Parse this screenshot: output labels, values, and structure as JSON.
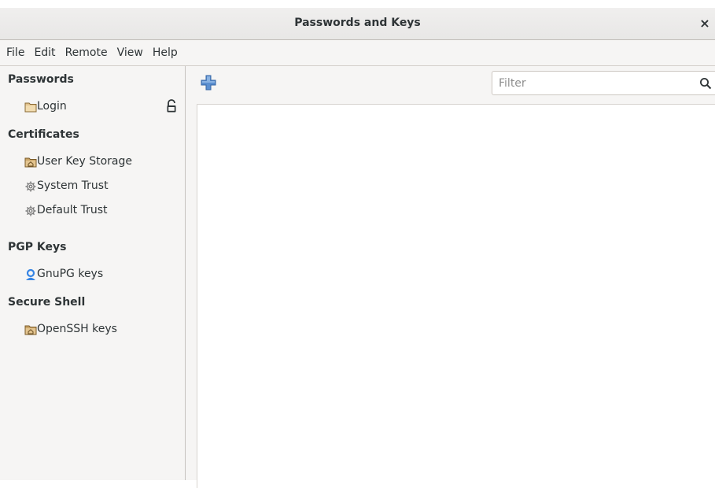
{
  "window": {
    "title": "Passwords and Keys",
    "close_symbol": "×"
  },
  "menu": [
    "File",
    "Edit",
    "Remote",
    "View",
    "Help"
  ],
  "sidebar": {
    "sections": [
      {
        "title": "Passwords",
        "items": [
          {
            "label": "Login",
            "icon": "folder-icon",
            "locked": true
          }
        ]
      },
      {
        "title": "Certificates",
        "items": [
          {
            "label": "User Key Storage",
            "icon": "home-folder-icon"
          },
          {
            "label": "System Trust",
            "icon": "gear-icon"
          },
          {
            "label": "Default Trust",
            "icon": "gear-icon"
          }
        ]
      },
      {
        "title": "PGP Keys",
        "items": [
          {
            "label": "GnuPG keys",
            "icon": "person-key-icon"
          }
        ]
      },
      {
        "title": "Secure Shell",
        "items": [
          {
            "label": "OpenSSH keys",
            "icon": "home-folder-icon"
          }
        ]
      }
    ]
  },
  "toolbar": {
    "add_icon": "add-icon",
    "filter_placeholder": "Filter",
    "filter_value": ""
  },
  "colors": {
    "accent_blue": "#3584e4",
    "folder": "#d9b77a"
  }
}
